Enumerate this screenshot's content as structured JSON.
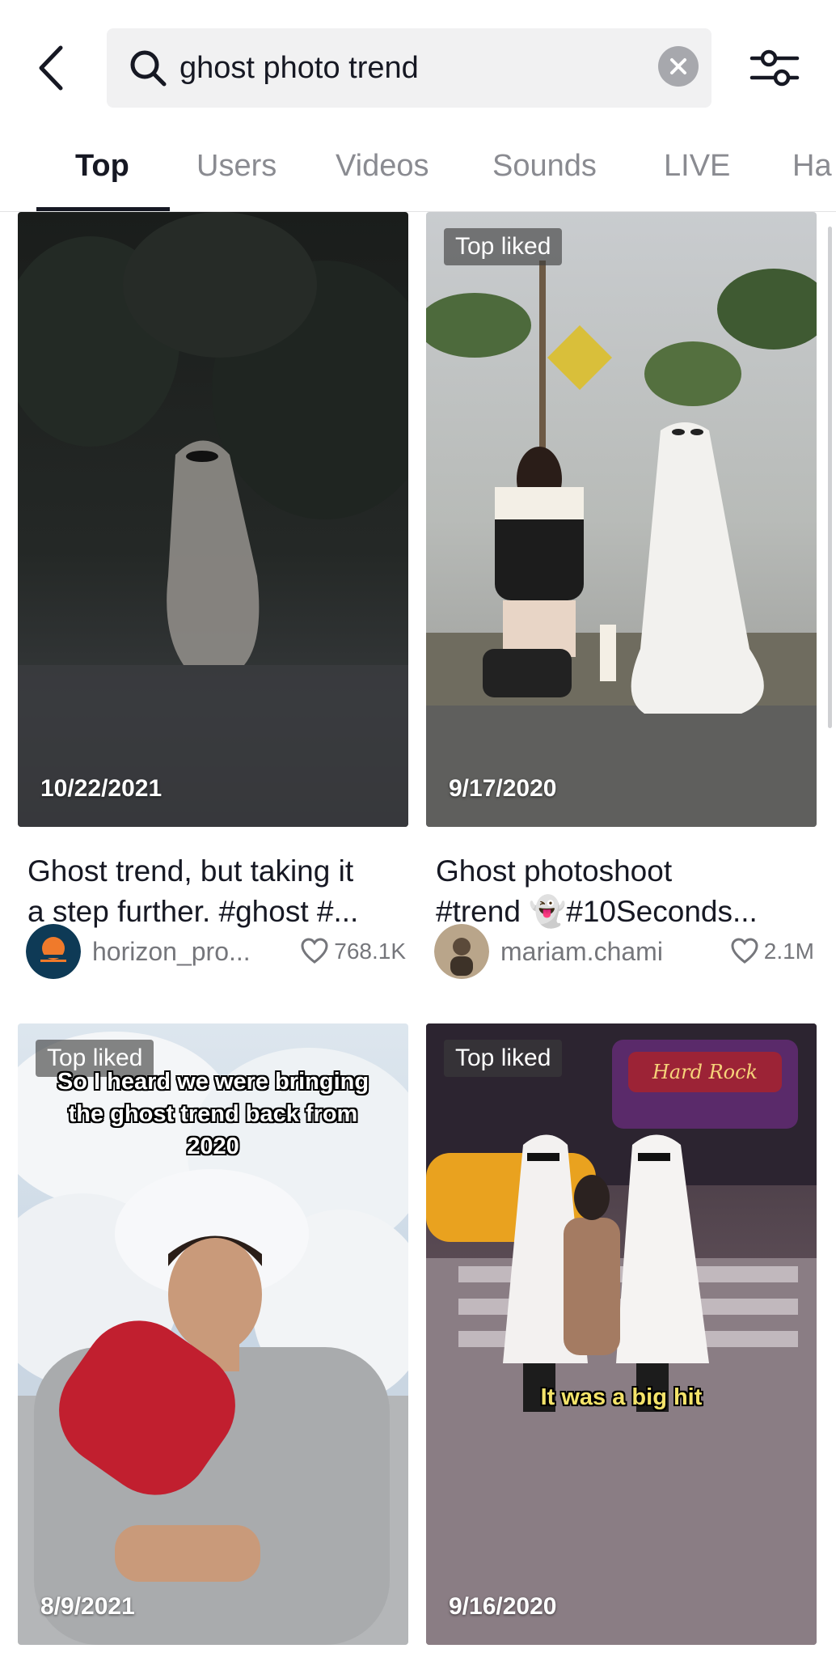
{
  "search": {
    "query": "ghost photo trend"
  },
  "tabs": [
    {
      "label": "Top"
    },
    {
      "label": "Users"
    },
    {
      "label": "Videos"
    },
    {
      "label": "Sounds"
    },
    {
      "label": "LIVE"
    },
    {
      "label": "Ha"
    }
  ],
  "active_tab": "Top",
  "videos": [
    {
      "badge": "",
      "date": "10/22/2021",
      "caption_line1": "Ghost trend, but taking it",
      "caption_line2": "a step further. #ghost #...",
      "username": "horizon_pro...",
      "likes": "768.1K"
    },
    {
      "badge": "Top liked",
      "date": "9/17/2020",
      "caption_line1": "Ghost photoshoot",
      "caption_line2": "#trend 👻#10Seconds...",
      "username": "mariam.chami",
      "likes": "2.1M"
    },
    {
      "badge": "Top liked",
      "date": "8/9/2021",
      "overlay_text": "So I heard we were bringing\nthe ghost trend back from\n2020"
    },
    {
      "badge": "Top liked",
      "date": "9/16/2020",
      "overlay_text": "It was a big hit",
      "sign_text": "Hard Rock"
    }
  ],
  "colors": {
    "text_primary": "#161823",
    "text_secondary": "#75767b",
    "tab_inactive": "#8a8b91",
    "search_bg": "#f1f1f2"
  }
}
